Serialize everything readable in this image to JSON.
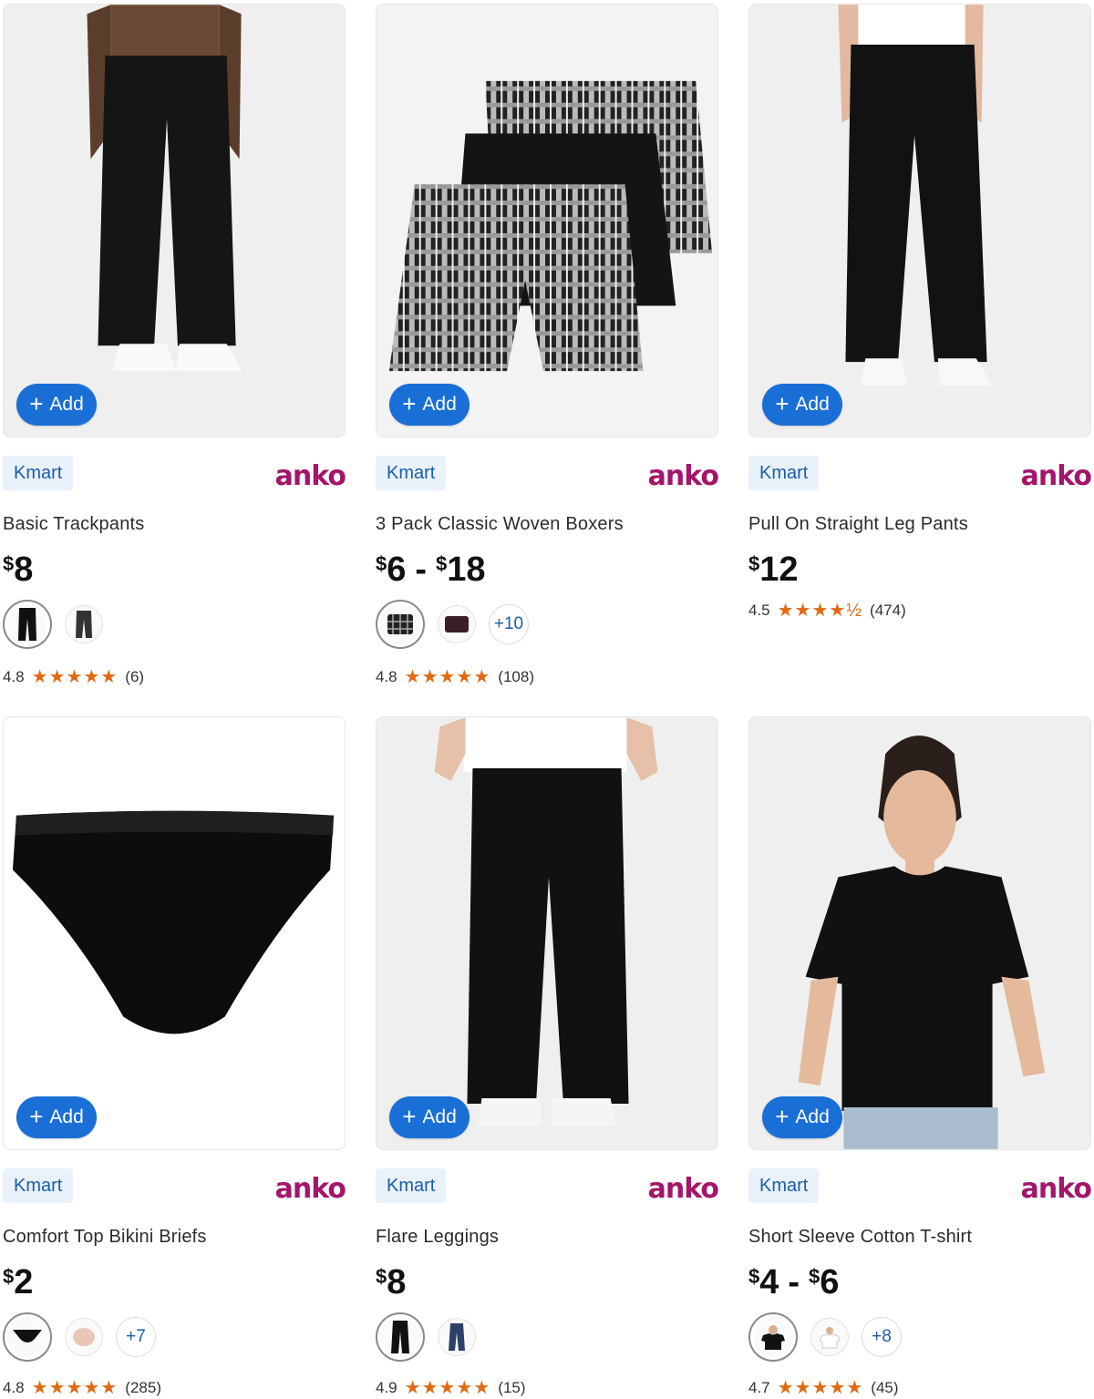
{
  "add_label": "Add",
  "colors": {
    "accent": "#1a6fd6",
    "brand": "#a3166a",
    "star": "#e06a14",
    "badge_bg": "#e9f1fa"
  },
  "products": [
    {
      "seller": "Kmart",
      "brand": "anko",
      "title": "Basic Trackpants",
      "price_from": "8",
      "price_to": "",
      "currency": "$",
      "more_colors": "",
      "rating": "4.8",
      "stars": "★★★★★",
      "reviews": "(6)"
    },
    {
      "seller": "Kmart",
      "brand": "anko",
      "title": "3 Pack Classic Woven Boxers",
      "price_from": "6",
      "price_to": "18",
      "currency": "$",
      "more_colors": "+10",
      "rating": "4.8",
      "stars": "★★★★★",
      "reviews": "(108)"
    },
    {
      "seller": "Kmart",
      "brand": "anko",
      "title": "Pull On Straight Leg Pants",
      "price_from": "12",
      "price_to": "",
      "currency": "$",
      "more_colors": "",
      "rating": "4.5",
      "stars": "★★★★½",
      "reviews": "(474)"
    },
    {
      "seller": "Kmart",
      "brand": "anko",
      "title": "Comfort Top Bikini Briefs",
      "price_from": "2",
      "price_to": "",
      "currency": "$",
      "more_colors": "+7",
      "rating": "4.8",
      "stars": "★★★★★",
      "reviews": "(285)"
    },
    {
      "seller": "Kmart",
      "brand": "anko",
      "title": "Flare Leggings",
      "price_from": "8",
      "price_to": "",
      "currency": "$",
      "more_colors": "",
      "rating": "4.9",
      "stars": "★★★★★",
      "reviews": "(15)"
    },
    {
      "seller": "Kmart",
      "brand": "anko",
      "title": "Short Sleeve Cotton T-shirt",
      "price_from": "4",
      "price_to": "6",
      "currency": "$",
      "more_colors": "+8",
      "rating": "4.7",
      "stars": "★★★★★",
      "reviews": "(45)"
    }
  ]
}
